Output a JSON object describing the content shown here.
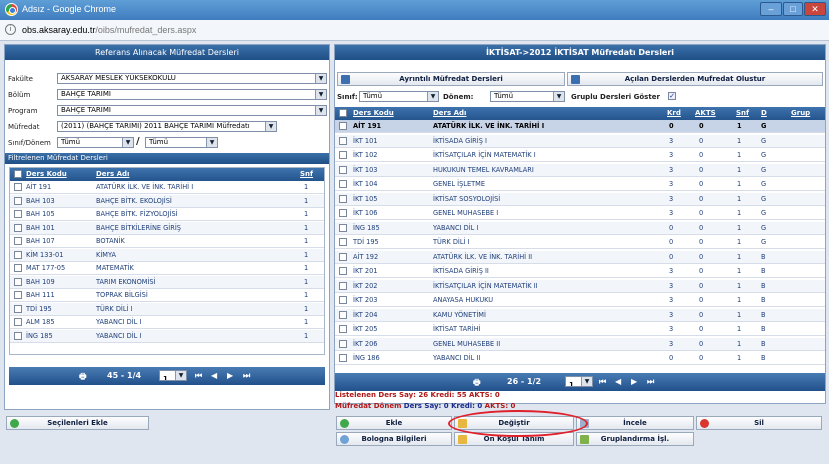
{
  "window": {
    "title": "Adsız - Google Chrome",
    "min": "‒",
    "max": "□",
    "close": "✕"
  },
  "address": {
    "host": "obs.aksaray.edu.tr",
    "path": "/oibs/mufredat_ders.aspx"
  },
  "left": {
    "title": "Referans Alınacak Müfredat Dersleri",
    "fakulte_label": "Fakülte",
    "fakulte_value": "AKSARAY MESLEK YÜKSEKOKULU",
    "bolum_label": "Bölüm",
    "bolum_value": "BAHÇE TARIMI",
    "program_label": "Program",
    "program_value": "BAHÇE TARIMI",
    "mufredat_label": "Müfredat",
    "mufredat_value": "(2011) (BAHÇE TARIMI) 2011 BAHÇE TARIMI Müfredatı",
    "sinif_label": "Sınıf/Dönem",
    "sinif_value": "Tümü",
    "slash": "/",
    "donem_value": "Tümü",
    "filtered_title": "Filtrelenen Müfredat Dersleri",
    "col_code": "Ders Kodu",
    "col_name": "Ders Adı",
    "col_snf": "Snf",
    "rows": [
      {
        "code": "AİT 191",
        "name": "ATATÜRK İLK. VE İNK. TARİHİ I",
        "snf": "1"
      },
      {
        "code": "BAH 103",
        "name": "BAHÇE BİTK. EKOLOJİSİ",
        "snf": "1"
      },
      {
        "code": "BAH 105",
        "name": "BAHÇE BİTK. FİZYOLOJİSİ",
        "snf": "1"
      },
      {
        "code": "BAH 101",
        "name": "BAHÇE BİTKİLERİNE GİRİŞ",
        "snf": "1"
      },
      {
        "code": "BAH 107",
        "name": "BOTANİK",
        "snf": "1"
      },
      {
        "code": "KİM 133-01",
        "name": "KİMYA",
        "snf": "1"
      },
      {
        "code": "MAT 177-05",
        "name": "MATEMATİK",
        "snf": "1"
      },
      {
        "code": "BAH 109",
        "name": "TARIM EKONOMİSİ",
        "snf": "1"
      },
      {
        "code": "BAH 111",
        "name": "TOPRAK BİLGİSİ",
        "snf": "1"
      },
      {
        "code": "TDİ 195",
        "name": "TÜRK DİLİ I",
        "snf": "1"
      },
      {
        "code": "ALM 185",
        "name": "YABANCI DİL I",
        "snf": "1"
      },
      {
        "code": "İNG 185",
        "name": "YABANCI DİL I",
        "snf": "1"
      }
    ],
    "pager_text": "45 - 1/4",
    "page_value": "1",
    "add_selected": "Seçilenleri Ekle"
  },
  "right": {
    "title": "İKTİSAT->2012 İKTİSAT Müfredatı Dersleri",
    "detail_button": "Ayrıntılı Müfredat Dersleri",
    "create_button": "Açılan Derslerden Mufredat Olustur",
    "sinif_label": "Sınıf:",
    "sinif_value": "Tümü",
    "donem_label": "Dönem:",
    "donem_value": "Tümü",
    "grouped_label": "Gruplu Dersleri Göster",
    "cols": {
      "code": "Ders Kodu",
      "name": "Ders Adı",
      "krd": "Krd",
      "akts": "AKTS",
      "snf": "Snf",
      "d": "D",
      "grup": "Grup"
    },
    "rows": [
      {
        "code": "AİT 191",
        "name": "ATATÜRK İLK. VE İNK. TARİHİ I",
        "krd": "0",
        "akts": "0",
        "snf": "1",
        "d": "G"
      },
      {
        "code": "İKT 101",
        "name": "İKTİSADA GİRİŞ I",
        "krd": "3",
        "akts": "0",
        "snf": "1",
        "d": "G"
      },
      {
        "code": "İKT 102",
        "name": "İKTİSATÇILAR İÇİN MATEMATİK I",
        "krd": "3",
        "akts": "0",
        "snf": "1",
        "d": "G"
      },
      {
        "code": "İKT 103",
        "name": "HUKUKUN TEMEL KAVRAMLARI",
        "krd": "3",
        "akts": "0",
        "snf": "1",
        "d": "G"
      },
      {
        "code": "İKT 104",
        "name": "GENEL İŞLETME",
        "krd": "3",
        "akts": "0",
        "snf": "1",
        "d": "G"
      },
      {
        "code": "İKT 105",
        "name": "İKTİSAT SOSYOLOJİSİ",
        "krd": "3",
        "akts": "0",
        "snf": "1",
        "d": "G"
      },
      {
        "code": "İKT 106",
        "name": "GENEL MUHASEBE I",
        "krd": "3",
        "akts": "0",
        "snf": "1",
        "d": "G"
      },
      {
        "code": "İNG 185",
        "name": "YABANCI DİL I",
        "krd": "0",
        "akts": "0",
        "snf": "1",
        "d": "G"
      },
      {
        "code": "TDİ 195",
        "name": "TÜRK DİLİ I",
        "krd": "0",
        "akts": "0",
        "snf": "1",
        "d": "G"
      },
      {
        "code": "AİT 192",
        "name": "ATATÜRK İLK. VE İNK. TARİHİ II",
        "krd": "0",
        "akts": "0",
        "snf": "1",
        "d": "B"
      },
      {
        "code": "İKT 201",
        "name": "İKTİSADA GİRİŞ II",
        "krd": "3",
        "akts": "0",
        "snf": "1",
        "d": "B"
      },
      {
        "code": "İKT 202",
        "name": "İKTİSATÇILAR İÇİN MATEMATİK II",
        "krd": "3",
        "akts": "0",
        "snf": "1",
        "d": "B"
      },
      {
        "code": "İKT 203",
        "name": "ANAYASA HUKUKU",
        "krd": "3",
        "akts": "0",
        "snf": "1",
        "d": "B"
      },
      {
        "code": "İKT 204",
        "name": "KAMU YÖNETİMİ",
        "krd": "3",
        "akts": "0",
        "snf": "1",
        "d": "B"
      },
      {
        "code": "İKT 205",
        "name": "İKTİSAT TARİHİ",
        "krd": "3",
        "akts": "0",
        "snf": "1",
        "d": "B"
      },
      {
        "code": "İKT 206",
        "name": "GENEL MUHASEBE II",
        "krd": "3",
        "akts": "0",
        "snf": "1",
        "d": "B"
      },
      {
        "code": "İNG 186",
        "name": "YABANCI DİL II",
        "krd": "0",
        "akts": "0",
        "snf": "1",
        "d": "B"
      }
    ],
    "pager_text": "26 - 1/2",
    "page_value": "1",
    "stat1": "Listelenen Ders Say: 26 Kredi: 55  AKTS: 0",
    "stat2_a": "Müfredat Dönem ",
    "stat2_b": "Ders Say: 0 ",
    "stat2_c": "Kredi: 0  ",
    "stat2_d": "AKTS: 0",
    "buttons": {
      "ekle": "Ekle",
      "degistir": "Değiştir",
      "incele": "İncele",
      "sil": "Sil",
      "bologna": "Bologna Bilgileri",
      "onkosul": "Ön Koşul Tanım",
      "grup": "Gruplandırma İşl."
    }
  },
  "colors": {
    "highlight_ellipse": "#e0202a"
  }
}
